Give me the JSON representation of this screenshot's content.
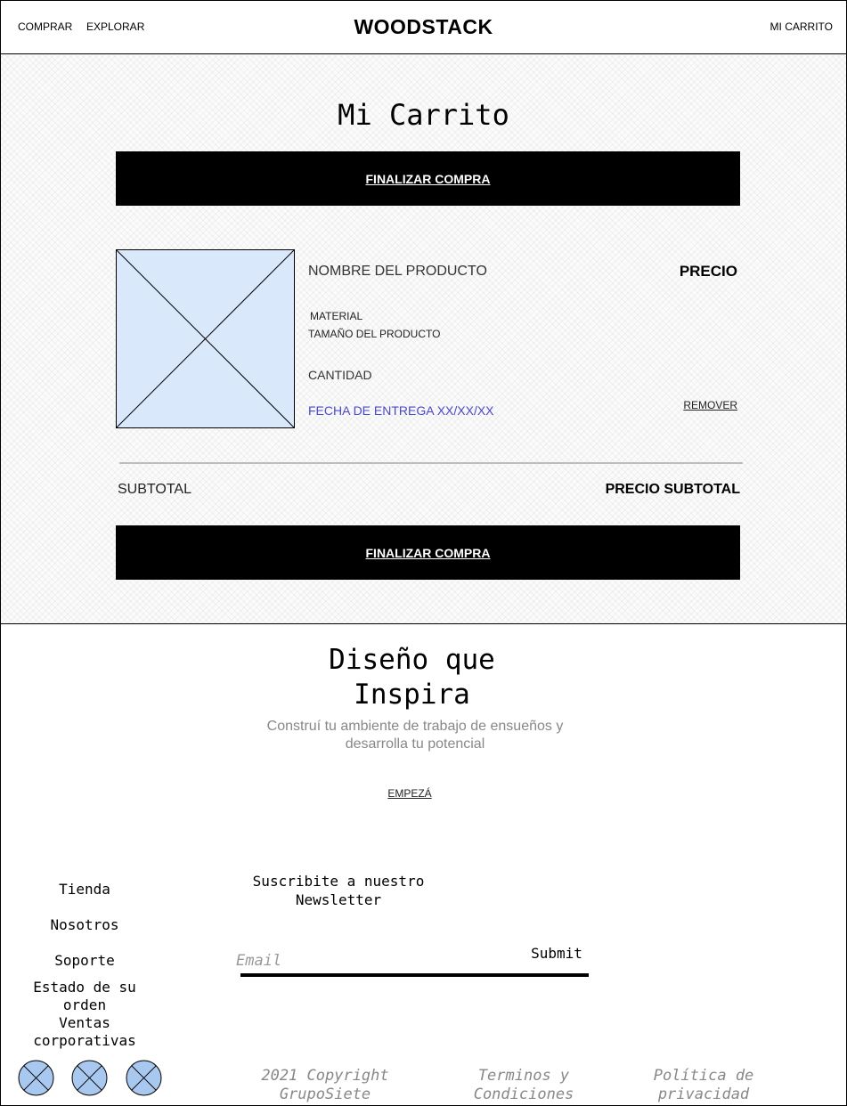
{
  "header": {
    "nav": [
      "COMPRAR",
      "EXPLORAR"
    ],
    "brand": "WOODSTACK",
    "cart_link": "MI CARRITO"
  },
  "cart": {
    "title": "Mi Carrito",
    "checkout_label": "FINALIZAR COMPRA",
    "product": {
      "name": "NOMBRE DEL PRODUCTO",
      "material": "MATERIAL",
      "size": "TAMAÑO DEL PRODUCTO",
      "quantity": "CANTIDAD",
      "delivery": "FECHA DE ENTREGA XX/XX/XX",
      "price": "PRECIO",
      "remove": "REMOVER"
    },
    "subtotal_label": "SUBTOTAL",
    "subtotal_value": "PRECIO SUBTOTAL"
  },
  "hero": {
    "title": "Diseño que Inspira",
    "subtitle": "Construí tu ambiente de trabajo de ensueños y desarrolla tu potencial",
    "cta": "EMPEZÁ"
  },
  "footer": {
    "links": [
      "Tienda",
      "Nosotros",
      "Soporte",
      "Estado de su orden",
      "Ventas corporativas"
    ],
    "newsletter_title": "Suscribite a nuestro Newsletter",
    "email_placeholder": "Email",
    "submit": "Submit",
    "copyright": "2021 Copyright GrupoSiete",
    "terms": "Terminos y Condiciones",
    "privacy": "Política de privacidad",
    "social_icons": [
      "social-icon",
      "social-icon",
      "social-icon"
    ]
  },
  "colors": {
    "placeholder_fill": "#dae8fc",
    "social_fill": "#a9c8ef",
    "delivery_text": "#4a4ac8"
  }
}
